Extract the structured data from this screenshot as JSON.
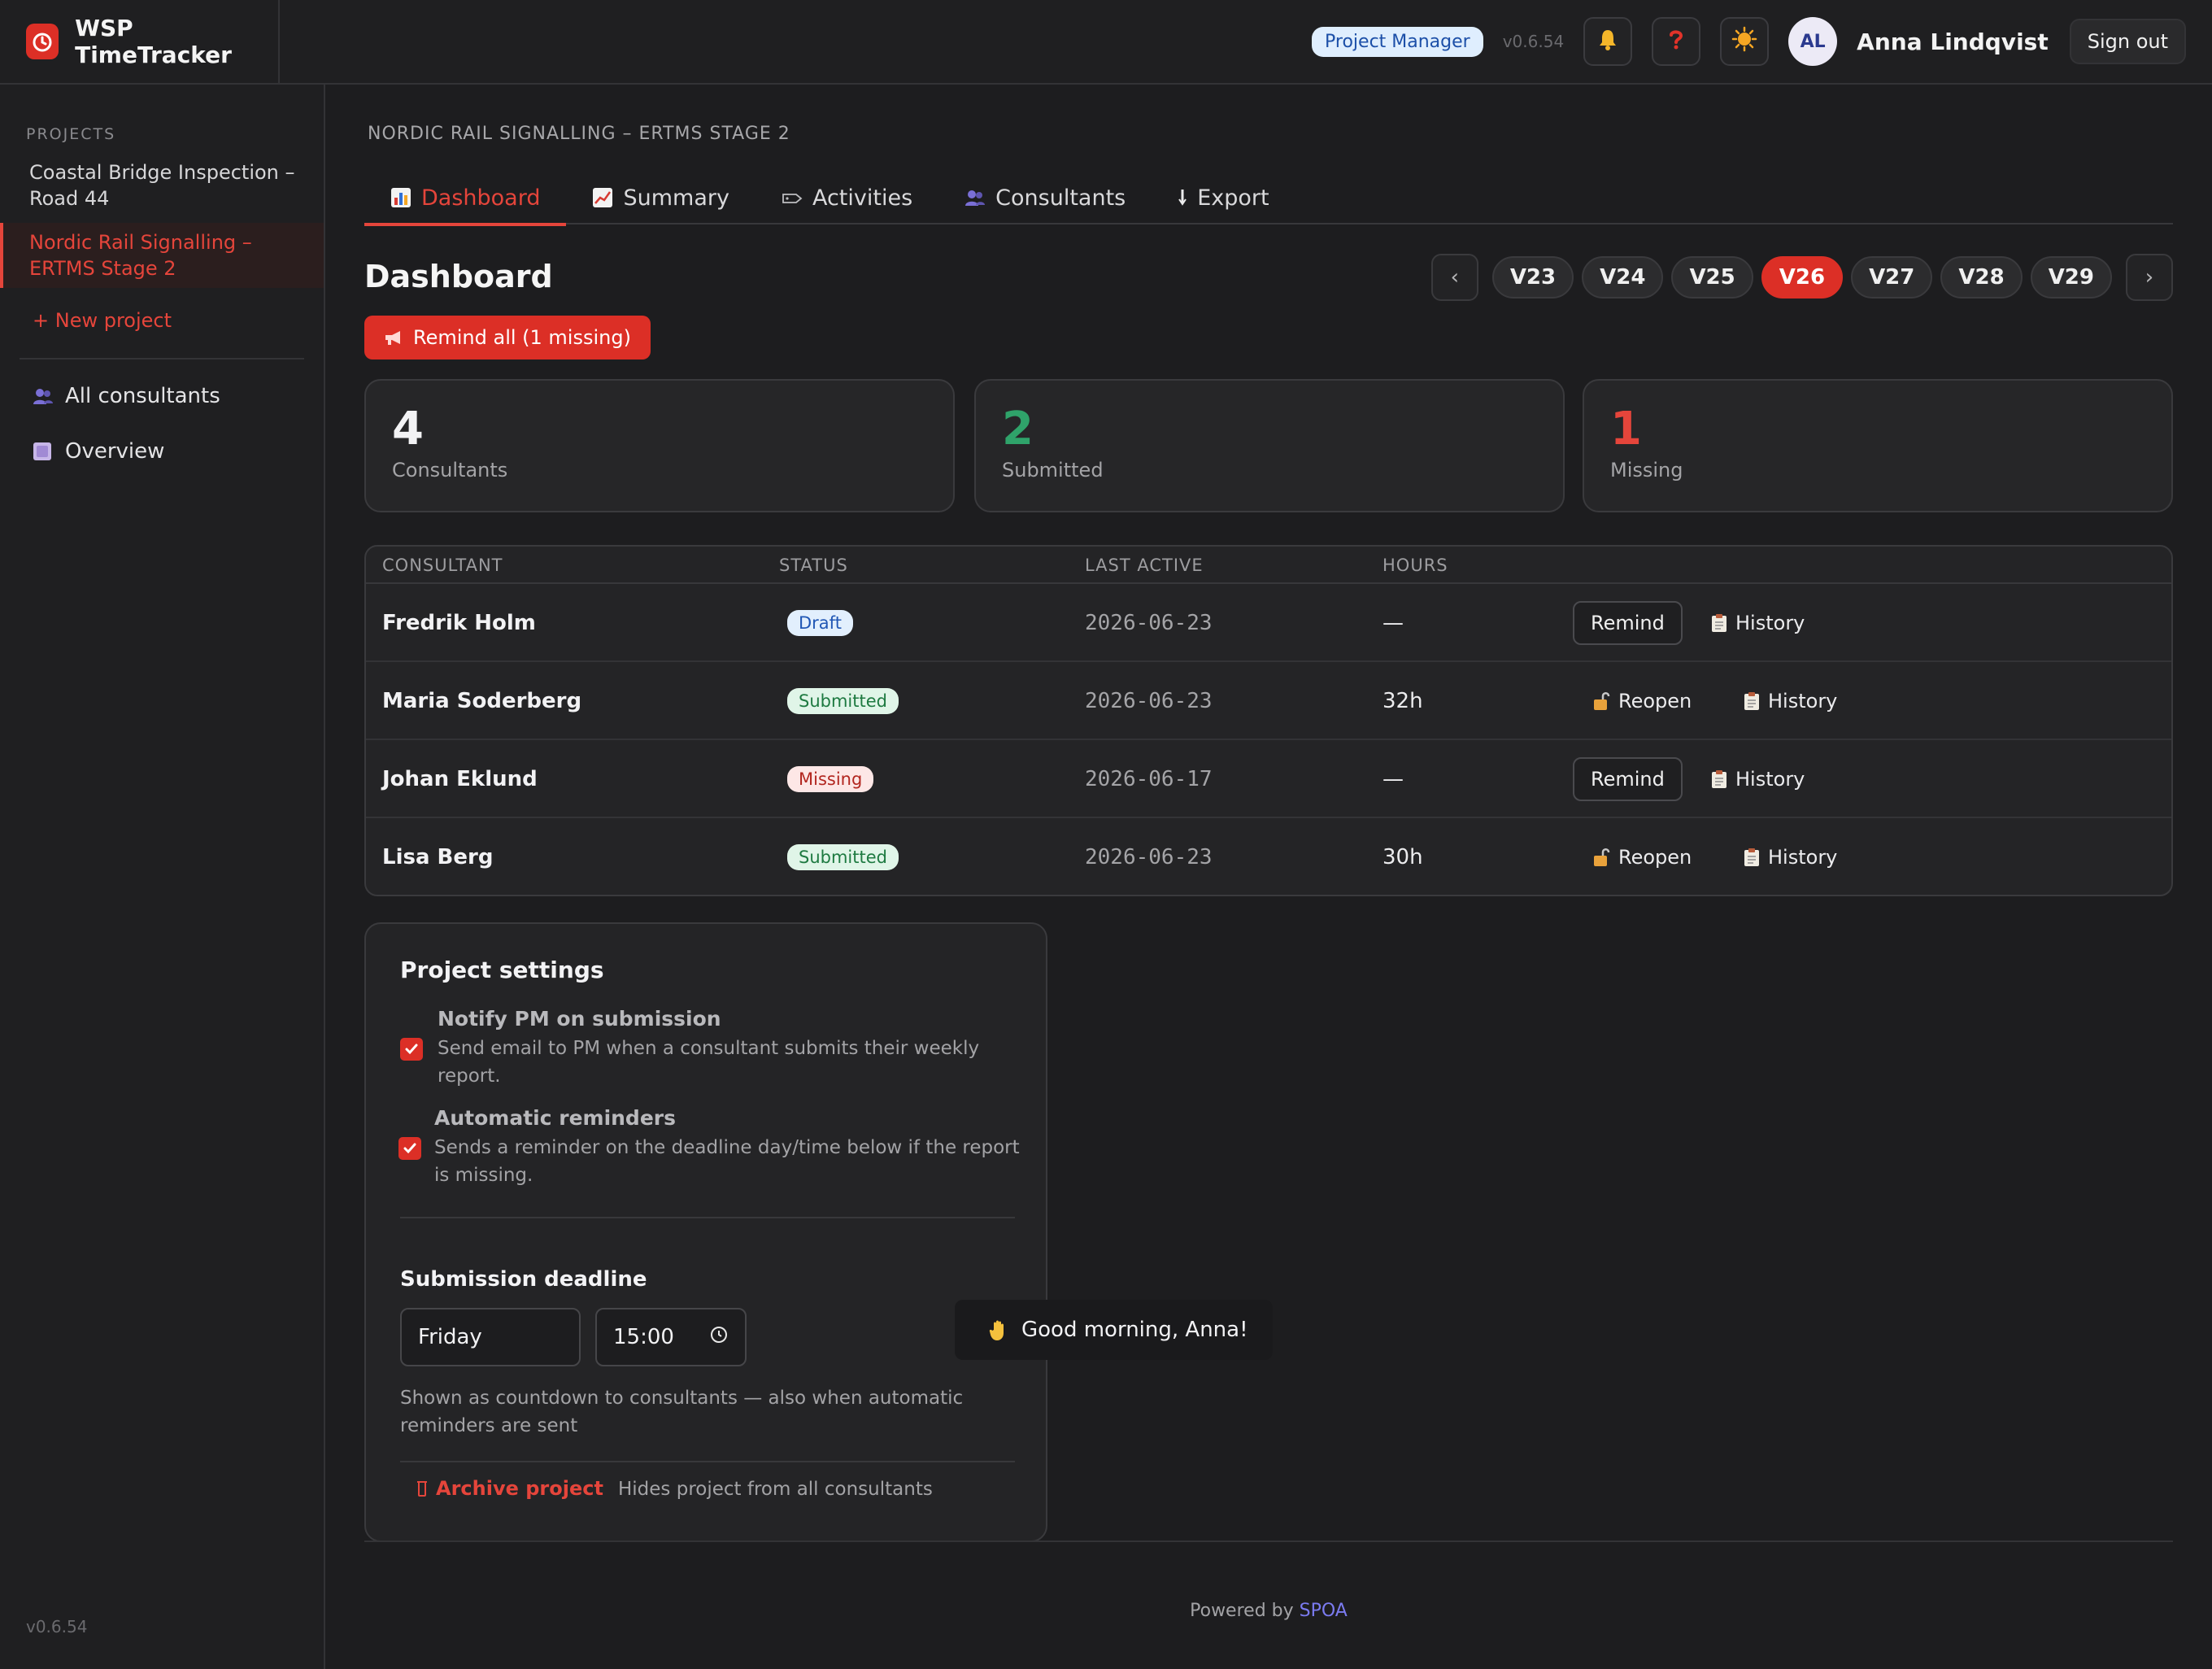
{
  "header": {
    "brand": "WSP TimeTracker",
    "role_badge": "Project Manager",
    "version": "v0.6.54",
    "avatar_initials": "AL",
    "user_name": "Anna Lindqvist",
    "sign_out": "Sign out"
  },
  "sidebar": {
    "section_label": "PROJECTS",
    "projects": [
      {
        "line1": "Coastal Bridge Inspection –",
        "line2": "Road 44",
        "active": false
      },
      {
        "line1": "Nordic Rail Signalling –",
        "line2": "ERTMS Stage 2",
        "active": true
      }
    ],
    "new_project": "+ New project",
    "items": [
      {
        "label": "All consultants",
        "icon": "people-icon"
      },
      {
        "label": "Overview",
        "icon": "square-icon"
      }
    ],
    "version": "v0.6.54"
  },
  "main": {
    "breadcrumb": "NORDIC RAIL SIGNALLING – ERTMS STAGE 2",
    "tabs": [
      {
        "label": "Dashboard",
        "icon": "bar-chart-icon",
        "active": true
      },
      {
        "label": "Summary",
        "icon": "line-chart-icon",
        "active": false
      },
      {
        "label": "Activities",
        "icon": "tag-icon",
        "active": false
      },
      {
        "label": "Consultants",
        "icon": "people-icon",
        "active": false
      },
      {
        "label": "Export",
        "icon": "download-icon",
        "active": false
      }
    ],
    "title": "Dashboard",
    "weeks": [
      "V23",
      "V24",
      "V25",
      "V26",
      "V27",
      "V28",
      "V29"
    ],
    "active_week": "V26",
    "week_prev": "‹",
    "week_next": "›",
    "remind_all": "Remind all (1 missing)",
    "stats": [
      {
        "value": "4",
        "label": "Consultants",
        "color": "#f2f2f4"
      },
      {
        "value": "2",
        "label": "Submitted",
        "color": "#2fa36a"
      },
      {
        "value": "1",
        "label": "Missing",
        "color": "#e5453b"
      }
    ],
    "table": {
      "columns": [
        "CONSULTANT",
        "STATUS",
        "LAST ACTIVE",
        "HOURS"
      ],
      "rows": [
        {
          "name": "Fredrik Holm",
          "status": "Draft",
          "status_kind": "draft",
          "last_active": "2026-06-23",
          "hours": "—",
          "action": "Remind",
          "history": "History"
        },
        {
          "name": "Maria Soderberg",
          "status": "Submitted",
          "status_kind": "submitted",
          "last_active": "2026-06-23",
          "hours": "32h",
          "action": "Reopen",
          "history": "History"
        },
        {
          "name": "Johan Eklund",
          "status": "Missing",
          "status_kind": "missing",
          "last_active": "2026-06-17",
          "hours": "—",
          "action": "Remind",
          "history": "History"
        },
        {
          "name": "Lisa Berg",
          "status": "Submitted",
          "status_kind": "submitted",
          "last_active": "2026-06-23",
          "hours": "30h",
          "action": "Reopen",
          "history": "History"
        }
      ]
    },
    "settings": {
      "title": "Project settings",
      "notify_title": "Notify PM on submission",
      "notify_desc_1": "Send email to PM when a consultant submits their weekly",
      "notify_desc_2": "report.",
      "auto_title": "Automatic reminders",
      "auto_desc_1": "Sends a reminder on the deadline day/time below if the report",
      "auto_desc_2": "is missing.",
      "deadline_title": "Submission deadline",
      "deadline_day": "Friday",
      "deadline_time": "15:00",
      "deadline_hint_1": "Shown as countdown to consultants — also when automatic",
      "deadline_hint_2": "reminders are sent",
      "archive": "Archive project",
      "archive_hint": "Hides project from all consultants"
    }
  },
  "toast": "Good morning, Anna!",
  "footer": {
    "prefix": "Powered by",
    "brand": "SPOA"
  },
  "colors": {
    "accent": "#dc2f26",
    "submitted": "#2fa36a",
    "background": "#1d1d1f"
  }
}
